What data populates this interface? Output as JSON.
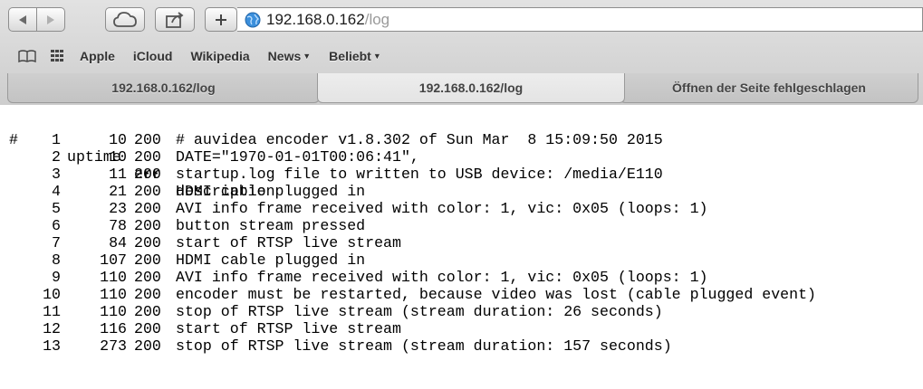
{
  "browser": {
    "address": {
      "host": "192.168.0.162",
      "path": "/log"
    },
    "bookmarks": [
      "Apple",
      "iCloud",
      "Wikipedia",
      "News",
      "Beliebt"
    ],
    "tabs": [
      {
        "label": "192.168.0.162/log",
        "active": false
      },
      {
        "label": "192.168.0.162/log",
        "active": true
      },
      {
        "label": "Öffnen der Seite fehlgeschlagen",
        "active": false
      }
    ]
  },
  "log": {
    "header": {
      "num": "#",
      "uptime": "uptime",
      "err": "err",
      "description": "description"
    },
    "rows": [
      {
        "num": "1",
        "uptime": "10",
        "err": "200",
        "description": "# auvidea encoder v1.8.302 of Sun Mar  8 15:09:50 2015"
      },
      {
        "num": "2",
        "uptime": "10",
        "err": "200",
        "description": "DATE=\"1970-01-01T00:06:41\","
      },
      {
        "num": "3",
        "uptime": "11",
        "err": "200",
        "description": "startup.log file to written to USB device: /media/E110"
      },
      {
        "num": "4",
        "uptime": "21",
        "err": "200",
        "description": "HDMI cable plugged in"
      },
      {
        "num": "5",
        "uptime": "23",
        "err": "200",
        "description": "AVI info frame received with color: 1, vic: 0x05 (loops: 1)"
      },
      {
        "num": "6",
        "uptime": "78",
        "err": "200",
        "description": "button stream pressed"
      },
      {
        "num": "7",
        "uptime": "84",
        "err": "200",
        "description": "start of RTSP live stream"
      },
      {
        "num": "8",
        "uptime": "107",
        "err": "200",
        "description": "HDMI cable plugged in"
      },
      {
        "num": "9",
        "uptime": "110",
        "err": "200",
        "description": "AVI info frame received with color: 1, vic: 0x05 (loops: 1)"
      },
      {
        "num": "10",
        "uptime": "110",
        "err": "200",
        "description": "encoder must be restarted, because video was lost (cable plugged event)"
      },
      {
        "num": "11",
        "uptime": "110",
        "err": "200",
        "description": "stop of RTSP live stream (stream duration: 26 seconds)"
      },
      {
        "num": "12",
        "uptime": "116",
        "err": "200",
        "description": "start of RTSP live stream"
      },
      {
        "num": "13",
        "uptime": "273",
        "err": "200",
        "description": "stop of RTSP live stream (stream duration: 157 seconds)"
      }
    ]
  }
}
